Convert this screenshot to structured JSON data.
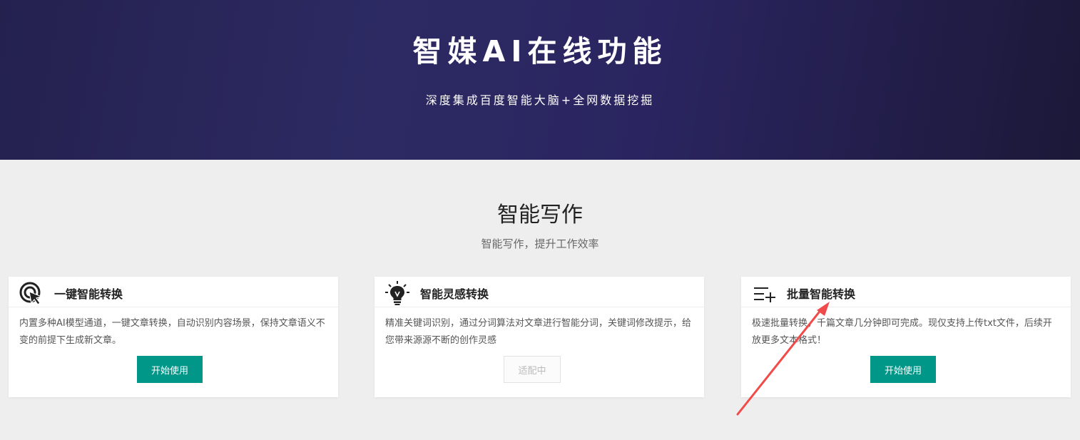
{
  "hero": {
    "title": "智媒AI在线功能",
    "subtitle": "深度集成百度智能大脑+全网数据挖掘"
  },
  "section": {
    "title": "智能写作",
    "subtitle": "智能写作，提升工作效率"
  },
  "cards": [
    {
      "title": "一键智能转换",
      "icon": "cursor-click-icon",
      "desc": "内置多种AI模型通道，一键文章转换，自动识别内容场景，保持文章语义不变的前提下生成新文章。",
      "button": "开始使用",
      "button_enabled": true
    },
    {
      "title": "智能灵感转换",
      "icon": "lightbulb-icon",
      "desc": "精准关键词识别，通过分词算法对文章进行智能分词，关键词修改提示，给您带来源源不断的创作灵感",
      "button": "适配中",
      "button_enabled": false
    },
    {
      "title": "批量智能转换",
      "icon": "list-add-icon",
      "desc": "极速批量转换，千篇文章几分钟即可完成。现仅支持上传txt文件，后续开放更多文本格式！",
      "button": "开始使用",
      "button_enabled": true
    }
  ],
  "colors": {
    "accent": "#009688",
    "hero_bg": "#2d2a63",
    "annotation_arrow": "#f04a4a"
  }
}
